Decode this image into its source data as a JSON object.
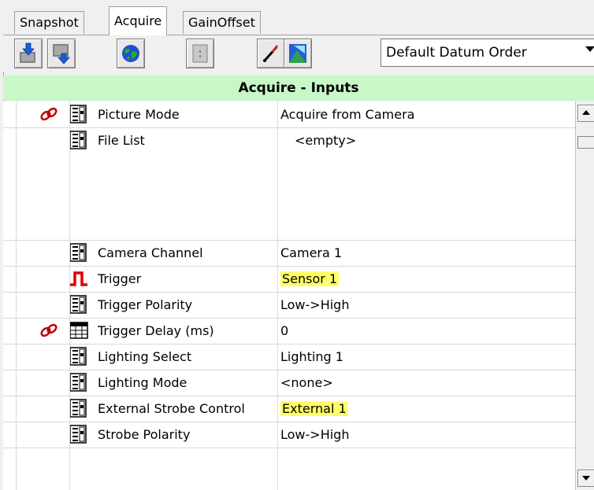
{
  "tabs": [
    {
      "label": "Snapshot"
    },
    {
      "label": "Acquire"
    },
    {
      "label": "GainOffset"
    }
  ],
  "toolbar": {
    "datum_order": "Default Datum Order"
  },
  "section": {
    "title": "Acquire - Inputs"
  },
  "rows": [
    {
      "label": "Picture Mode",
      "value": "Acquire from Camera",
      "icon": "list-settings-icon",
      "linked": true,
      "highlight": false
    },
    {
      "label": "File List",
      "value": "<empty>",
      "icon": "list-settings-icon",
      "linked": false,
      "highlight": false
    },
    {
      "label": "Camera Channel",
      "value": "Camera 1",
      "icon": "list-settings-icon",
      "linked": false,
      "highlight": false
    },
    {
      "label": "Trigger",
      "value": "Sensor 1",
      "icon": "pulse-icon",
      "linked": false,
      "highlight": true
    },
    {
      "label": "Trigger Polarity",
      "value": "Low->High",
      "icon": "list-settings-icon",
      "linked": false,
      "highlight": false
    },
    {
      "label": "Trigger Delay (ms)",
      "value": "0",
      "icon": "numeric-keypad-icon",
      "linked": true,
      "highlight": false
    },
    {
      "label": "Lighting Select",
      "value": "Lighting 1",
      "icon": "list-settings-icon",
      "linked": false,
      "highlight": false
    },
    {
      "label": "Lighting Mode",
      "value": "<none>",
      "icon": "list-settings-icon",
      "linked": false,
      "highlight": false
    },
    {
      "label": "External Strobe Control",
      "value": "External 1",
      "icon": "list-settings-icon",
      "linked": false,
      "highlight": true
    },
    {
      "label": "Strobe Polarity",
      "value": "Low->High",
      "icon": "list-settings-icon",
      "linked": false,
      "highlight": false
    }
  ],
  "colors": {
    "section_header_bg": "#c8f7c8",
    "highlight": "#ffff66",
    "link_icon": "#c00000",
    "pulse_icon": "#e00000"
  }
}
